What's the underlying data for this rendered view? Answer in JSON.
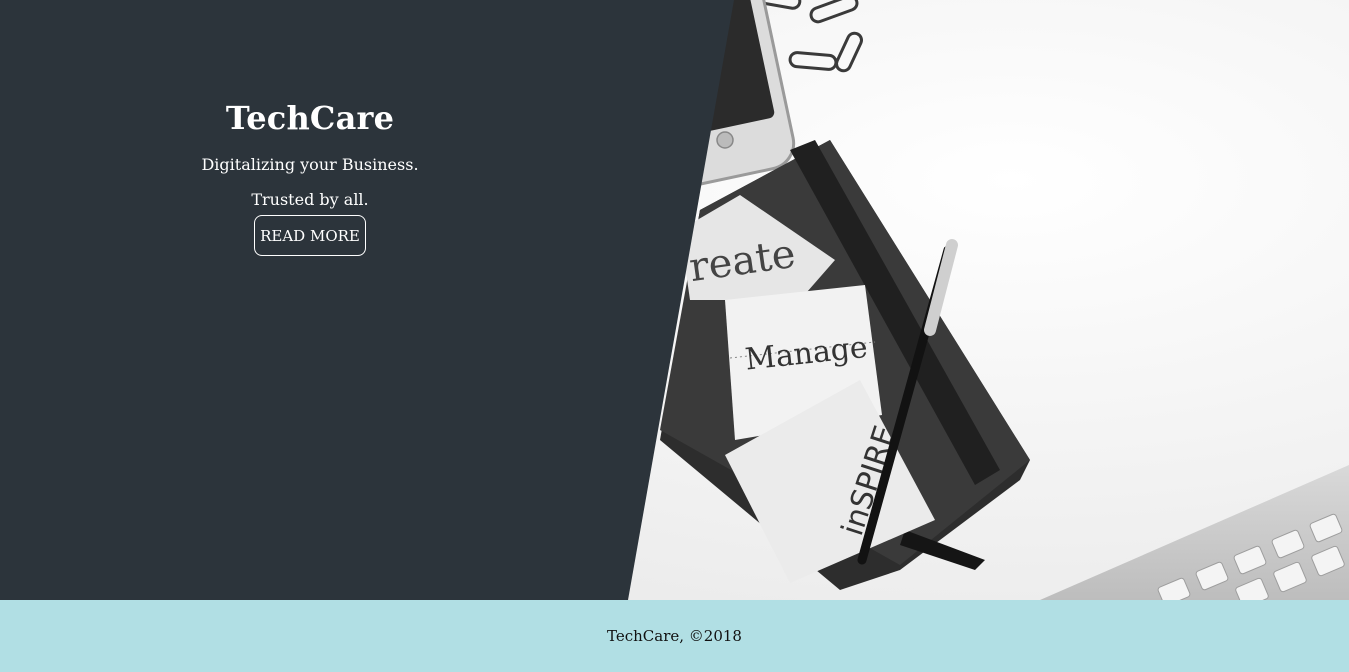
{
  "hero": {
    "title": "TechCare",
    "tagline_line1": "Digitalizing your Business.",
    "tagline_line2": "Trusted by all.",
    "button_label": "READ MORE"
  },
  "photo": {
    "note_labels": [
      "create",
      "Manage",
      "inSPIRE"
    ]
  },
  "footer": {
    "text": "TechCare, ©2018"
  },
  "colors": {
    "panel": "#2c343b",
    "footer": "#b1dfe4",
    "text_light": "#ffffff"
  }
}
